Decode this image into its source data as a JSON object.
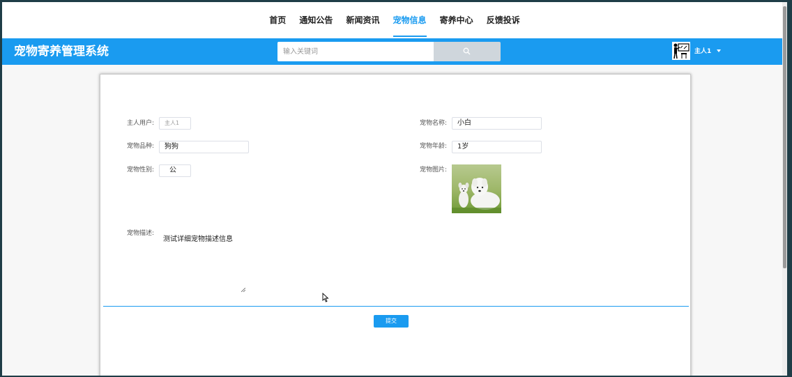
{
  "nav": {
    "items": [
      {
        "label": "首页",
        "active": false
      },
      {
        "label": "通知公告",
        "active": false
      },
      {
        "label": "新闻资讯",
        "active": false
      },
      {
        "label": "宠物信息",
        "active": true
      },
      {
        "label": "寄养中心",
        "active": false
      },
      {
        "label": "反馈投诉",
        "active": false
      }
    ]
  },
  "header": {
    "title": "宠物寄养管理系统",
    "search_placeholder": "输入关键词",
    "search_icon": "search-icon",
    "username": "主人1",
    "avatar_icon": "teacher-avatar-icon"
  },
  "form": {
    "owner_label": "主人用户:",
    "owner_value": "主人1",
    "pet_name_label": "宠物名称:",
    "pet_name_value": "小白",
    "breed_label": "宠物品种:",
    "breed_value": "狗狗",
    "age_label": "宠物年龄:",
    "age_value": "1岁",
    "gender_label": "宠物性别:",
    "gender_value": "公",
    "image_label": "宠物图片:",
    "desc_label": "宠物描述:",
    "desc_value": "测试详细宠物描述信息",
    "submit_label": "提交"
  },
  "colors": {
    "accent": "#1a9bf0",
    "search_button": "#cfd6dc"
  }
}
